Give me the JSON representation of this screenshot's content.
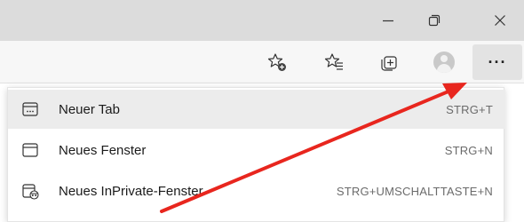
{
  "window": {
    "controls": [
      {
        "name": "minimize-button",
        "icon": "minimize-icon"
      },
      {
        "name": "restore-button",
        "icon": "restore-icon"
      },
      {
        "name": "close-button",
        "icon": "close-icon"
      }
    ]
  },
  "toolbar": {
    "icons": [
      "add-favorite-icon",
      "favorites-icon",
      "collections-icon",
      "profile-avatar"
    ],
    "more_label": "···"
  },
  "menu": {
    "items": [
      {
        "label": "Neuer Tab",
        "shortcut": "STRG+T",
        "icon": "new-tab-icon",
        "highlighted": true
      },
      {
        "label": "Neues Fenster",
        "shortcut": "STRG+N",
        "icon": "new-window-icon",
        "highlighted": false
      },
      {
        "label": "Neues InPrivate-Fenster",
        "shortcut": "STRG+UMSCHALTTASTE+N",
        "icon": "inprivate-window-icon",
        "highlighted": false
      }
    ]
  },
  "annotation": {
    "color": "#e8261e"
  }
}
